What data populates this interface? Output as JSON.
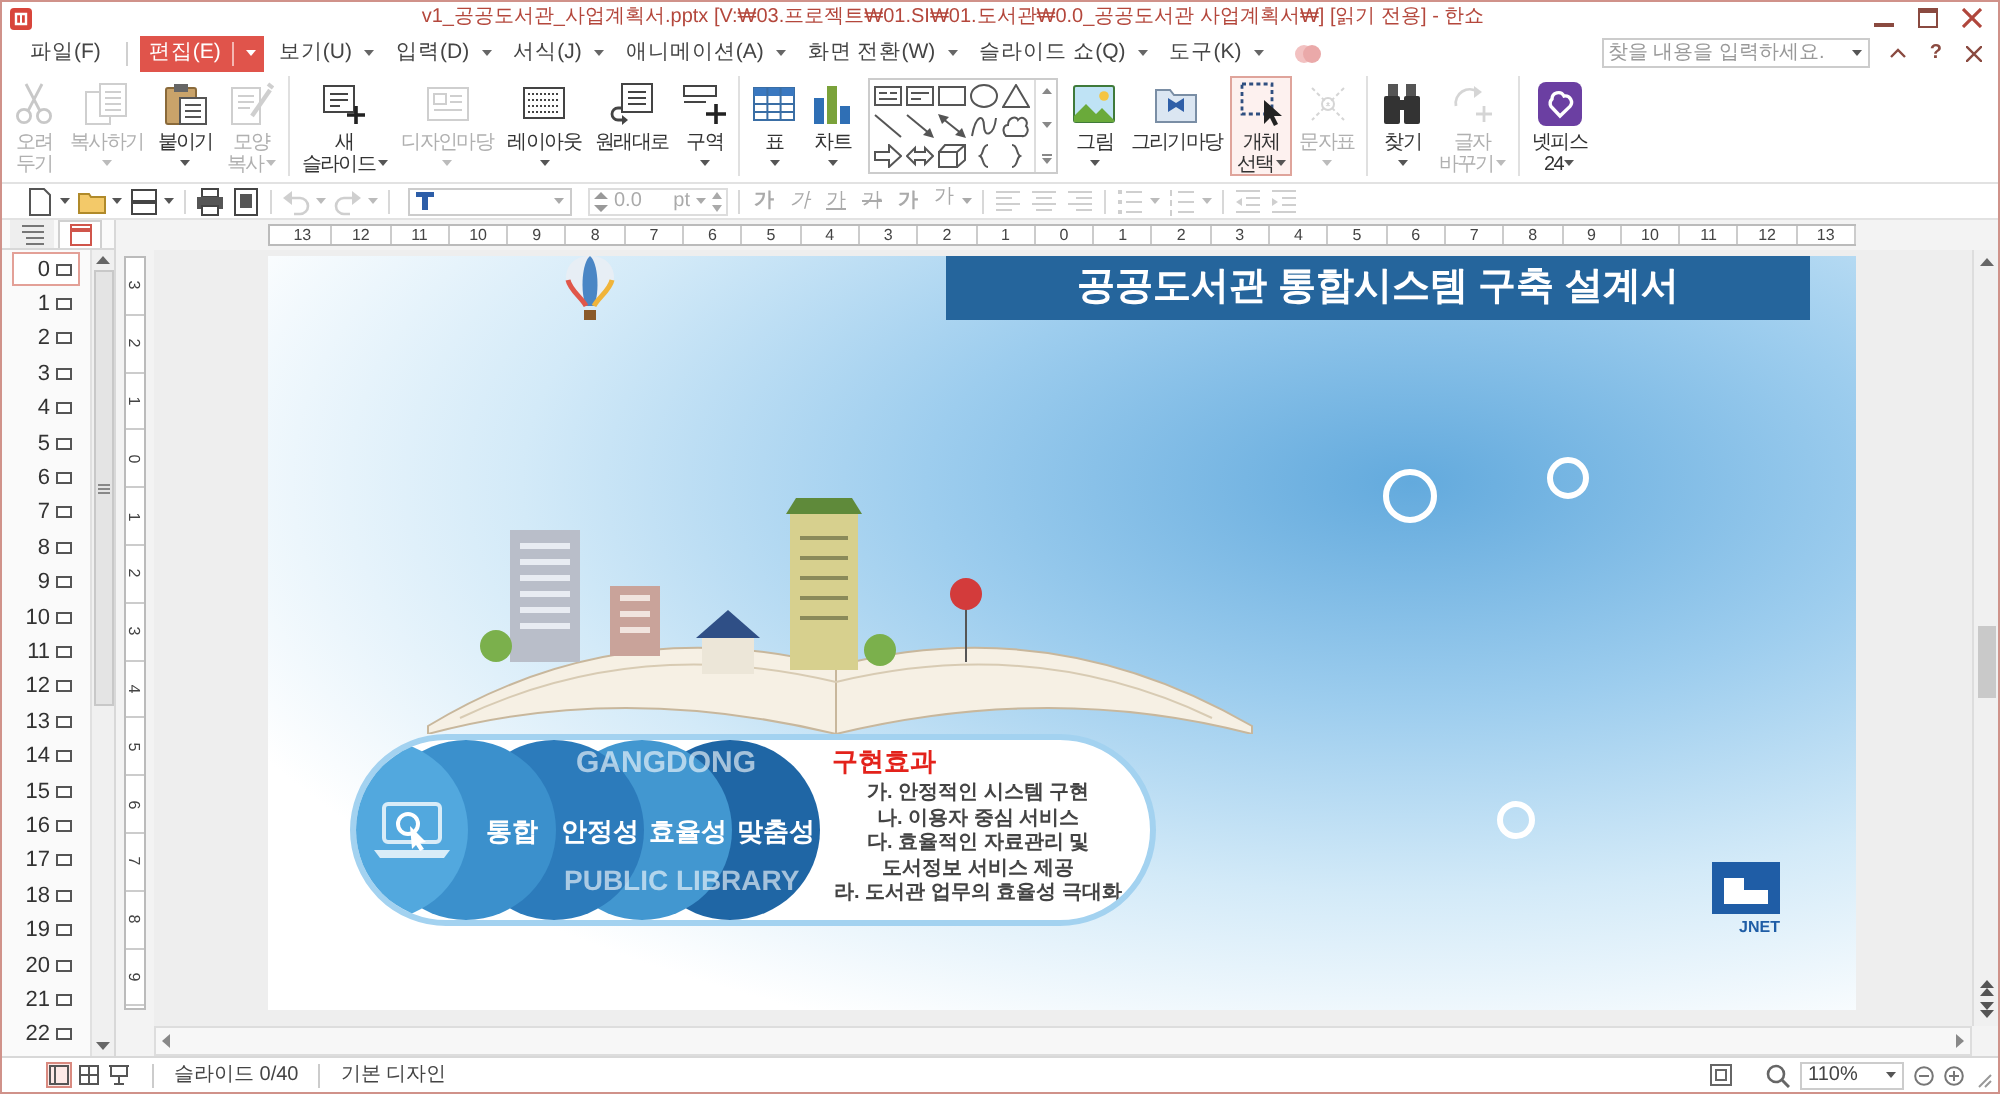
{
  "window": {
    "title": "v1_공공도서관_사업계획서.pptx [V:₩03.프로젝트₩01.SI₩01.도서관₩0.0_공공도서관 사업계획서₩] [읽기 전용] - 한쇼"
  },
  "menu_bar": {
    "items": [
      {
        "label": "파일(F)",
        "selected": false,
        "dropdown": false
      },
      {
        "label": "편집(E)",
        "selected": true,
        "dropdown": true
      },
      {
        "label": "보기(U)",
        "selected": false,
        "dropdown": true
      },
      {
        "label": "입력(D)",
        "selected": false,
        "dropdown": true
      },
      {
        "label": "서식(J)",
        "selected": false,
        "dropdown": true
      },
      {
        "label": "애니메이션(A)",
        "selected": false,
        "dropdown": true
      },
      {
        "label": "화면 전환(W)",
        "selected": false,
        "dropdown": true
      },
      {
        "label": "슬라이드 쇼(Q)",
        "selected": false,
        "dropdown": true
      },
      {
        "label": "도구(K)",
        "selected": false,
        "dropdown": true
      }
    ],
    "search": {
      "placeholder": "찾을 내용을 입력하세요."
    },
    "help": "?"
  },
  "ribbon": {
    "groups": [
      [
        {
          "kind": "button",
          "label": "오려\n두기",
          "disabled": true,
          "dropdown": false,
          "highlighted": false
        },
        {
          "kind": "button",
          "label": "복사하기",
          "disabled": true,
          "dropdown": true,
          "highlighted": false
        },
        {
          "kind": "button",
          "label": "붙이기",
          "disabled": false,
          "dropdown": true,
          "highlighted": false
        },
        {
          "kind": "button",
          "label": "모양\n복사",
          "disabled": true,
          "dropdown": true,
          "highlighted": false
        }
      ],
      [
        {
          "kind": "button",
          "label": "새\n슬라이드",
          "disabled": false,
          "dropdown": true,
          "highlighted": false
        },
        {
          "kind": "button",
          "label": "디자인마당",
          "disabled": true,
          "dropdown": true,
          "highlighted": false
        },
        {
          "kind": "button",
          "label": "레이아웃",
          "disabled": false,
          "dropdown": true,
          "highlighted": false
        },
        {
          "kind": "button",
          "label": "원래대로",
          "disabled": false,
          "dropdown": false,
          "highlighted": false
        },
        {
          "kind": "button",
          "label": "구역",
          "disabled": false,
          "dropdown": true,
          "highlighted": false
        }
      ],
      [
        {
          "kind": "button",
          "label": "표",
          "disabled": false,
          "dropdown": true,
          "highlighted": false
        },
        {
          "kind": "button",
          "label": "차트",
          "disabled": false,
          "dropdown": true,
          "highlighted": false
        },
        {
          "kind": "gallery"
        },
        {
          "kind": "button",
          "label": "그림",
          "disabled": false,
          "dropdown": true,
          "highlighted": false
        },
        {
          "kind": "button",
          "label": "그리기마당",
          "disabled": false,
          "dropdown": false,
          "highlighted": false
        },
        {
          "kind": "button",
          "label": "개체\n선택",
          "disabled": false,
          "dropdown": true,
          "highlighted": true
        },
        {
          "kind": "button",
          "label": "문자표",
          "disabled": true,
          "dropdown": true,
          "highlighted": false
        }
      ],
      [
        {
          "kind": "button",
          "label": "찾기",
          "disabled": false,
          "dropdown": true,
          "highlighted": false
        },
        {
          "kind": "button",
          "label": "글자\n바꾸기",
          "disabled": true,
          "dropdown": true,
          "highlighted": false
        }
      ],
      [
        {
          "kind": "button",
          "label": "넷피스\n24",
          "disabled": false,
          "dropdown": true,
          "highlighted": false
        }
      ]
    ]
  },
  "format_bar": {
    "groups": [
      [
        {
          "kind": "button",
          "disabled": false,
          "dropdown": true
        },
        {
          "kind": "button",
          "disabled": false,
          "dropdown": true
        },
        {
          "kind": "button",
          "disabled": false,
          "dropdown": true
        }
      ],
      [
        {
          "kind": "button",
          "disabled": false,
          "dropdown": false
        },
        {
          "kind": "button",
          "disabled": false,
          "dropdown": false
        }
      ],
      [
        {
          "kind": "button",
          "disabled": true,
          "dropdown": true
        },
        {
          "kind": "button",
          "disabled": true,
          "dropdown": true
        }
      ],
      [
        {
          "kind": "font-field"
        },
        {
          "kind": "size-field",
          "value": "0.0",
          "unit": "pt",
          "disabled": true
        }
      ],
      [
        {
          "kind": "text-button",
          "label": "가",
          "disabled": true,
          "dropdown": false
        },
        {
          "kind": "text-button",
          "label": "가",
          "disabled": true,
          "dropdown": false
        },
        {
          "kind": "text-button",
          "label": "가",
          "disabled": true,
          "dropdown": false
        },
        {
          "kind": "text-button",
          "label": "가",
          "disabled": true,
          "dropdown": false
        },
        {
          "kind": "text-button",
          "label": "가",
          "disabled": true,
          "dropdown": false
        },
        {
          "kind": "text-button",
          "label": "가",
          "disabled": true,
          "dropdown": true
        }
      ],
      [
        {
          "kind": "button",
          "disabled": true,
          "dropdown": false
        },
        {
          "kind": "button",
          "disabled": true,
          "dropdown": false
        },
        {
          "kind": "button",
          "disabled": true,
          "dropdown": false
        }
      ],
      [
        {
          "kind": "button",
          "disabled": true,
          "dropdown": true
        },
        {
          "kind": "button",
          "disabled": true,
          "dropdown": true
        }
      ],
      [
        {
          "kind": "button",
          "disabled": true,
          "dropdown": false
        },
        {
          "kind": "button",
          "disabled": true,
          "dropdown": false
        }
      ]
    ]
  },
  "slide_panel": {
    "tabs": [
      {
        "selected": false
      },
      {
        "selected": true
      }
    ],
    "items": [
      {
        "number": "0",
        "selected": true
      },
      {
        "number": "1",
        "selected": false
      },
      {
        "number": "2",
        "selected": false
      },
      {
        "number": "3",
        "selected": false
      },
      {
        "number": "4",
        "selected": false
      },
      {
        "number": "5",
        "selected": false
      },
      {
        "number": "6",
        "selected": false
      },
      {
        "number": "7",
        "selected": false
      },
      {
        "number": "8",
        "selected": false
      },
      {
        "number": "9",
        "selected": false
      },
      {
        "number": "10",
        "selected": false
      },
      {
        "number": "11",
        "selected": false
      },
      {
        "number": "12",
        "selected": false
      },
      {
        "number": "13",
        "selected": false
      },
      {
        "number": "14",
        "selected": false
      },
      {
        "number": "15",
        "selected": false
      },
      {
        "number": "16",
        "selected": false
      },
      {
        "number": "17",
        "selected": false
      },
      {
        "number": "18",
        "selected": false
      },
      {
        "number": "19",
        "selected": false
      },
      {
        "number": "20",
        "selected": false
      },
      {
        "number": "21",
        "selected": false
      },
      {
        "number": "22",
        "selected": false
      }
    ]
  },
  "rulers": {
    "horizontal": [
      "13",
      "12",
      "11",
      "10",
      "9",
      "8",
      "7",
      "6",
      "5",
      "4",
      "3",
      "2",
      "1",
      "0",
      "1",
      "2",
      "3",
      "4",
      "5",
      "6",
      "7",
      "8",
      "9",
      "10",
      "11",
      "12",
      "13"
    ],
    "vertical": [
      "3",
      "2",
      "1",
      "0",
      "1",
      "2",
      "3",
      "4",
      "5",
      "6",
      "7",
      "8",
      "9"
    ]
  },
  "slide": {
    "title": "공공도서관 통합시스템 구축 설계서",
    "values": [
      "통합",
      "안정성",
      "효율성",
      "맞춤성"
    ],
    "background_text": [
      "GANGDONG",
      "PUBLIC LIBRARY"
    ],
    "effects": {
      "heading": "구현효과",
      "items": [
        "가. 안정적인 시스템 구현",
        "나. 이용자 중심 서비스",
        "다. 효율적인 자료관리 및\n도서정보 서비스 제공",
        "라. 도서관 업무의 효율성 극대화"
      ]
    },
    "logo_text": "JNET"
  },
  "status_bar": {
    "views": [
      {
        "selected": true
      },
      {
        "selected": false
      },
      {
        "selected": false
      }
    ],
    "slide_counter": "슬라이드 0/40",
    "design": "기본 디자인",
    "zoom": "110%"
  }
}
